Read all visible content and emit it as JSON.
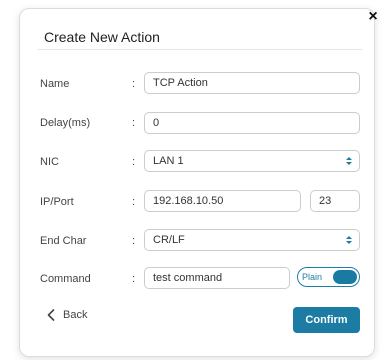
{
  "dialog": {
    "title": "Create New Action",
    "close_icon": "×",
    "fields": {
      "name": {
        "label": "Name",
        "value": "TCP Action"
      },
      "delay": {
        "label": "Delay(ms)",
        "value": "0"
      },
      "nic": {
        "label": "NIC",
        "value": "LAN 1"
      },
      "ipport": {
        "label": "IP/Port",
        "ip": "192.168.10.50",
        "port": "23"
      },
      "endchar": {
        "label": "End Char",
        "value": "CR/LF"
      },
      "command": {
        "label": "Command",
        "value": "test command",
        "toggle_label": "Plain"
      }
    },
    "separator": ":",
    "back_label": "Back",
    "back_icon": "chevron-left-icon",
    "confirm_label": "Confirm"
  },
  "colors": {
    "accent": "#1c7ca3",
    "border": "#c8cdd2"
  }
}
